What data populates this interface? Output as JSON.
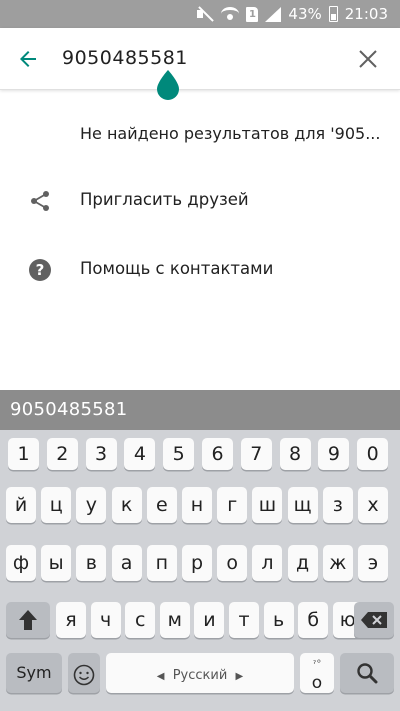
{
  "status_bar": {
    "battery": "43%",
    "time": "21:03",
    "sim": "1"
  },
  "search": {
    "query": "9050485581"
  },
  "results": {
    "no_results_text": "Не найдено результатов для '905...",
    "items": [
      {
        "label": "Пригласить друзей",
        "icon": "share-icon"
      },
      {
        "label": "Помощь с контактами",
        "icon": "help-icon"
      }
    ]
  },
  "keyboard": {
    "suggestion": "9050485581",
    "number_row": [
      "1",
      "2",
      "3",
      "4",
      "5",
      "6",
      "7",
      "8",
      "9",
      "0"
    ],
    "row1": [
      "й",
      "ц",
      "у",
      "к",
      "е",
      "н",
      "г",
      "ш",
      "щ",
      "з",
      "х"
    ],
    "row2": [
      "ф",
      "ы",
      "в",
      "а",
      "п",
      "р",
      "о",
      "л",
      "д",
      "ж",
      "э"
    ],
    "row3": [
      "я",
      "ч",
      "с",
      "м",
      "и",
      "т",
      "ь",
      "б",
      "ю"
    ],
    "sym_label": "Sym",
    "space_label": "Русский",
    "punct_label": "ˀ°",
    "punct_main": "о"
  },
  "colors": {
    "accent": "#00897b",
    "status_bar": "#9e9e9e",
    "suggestion_bar": "#8c8c8c",
    "keyboard_bg": "#d0d2d6"
  }
}
